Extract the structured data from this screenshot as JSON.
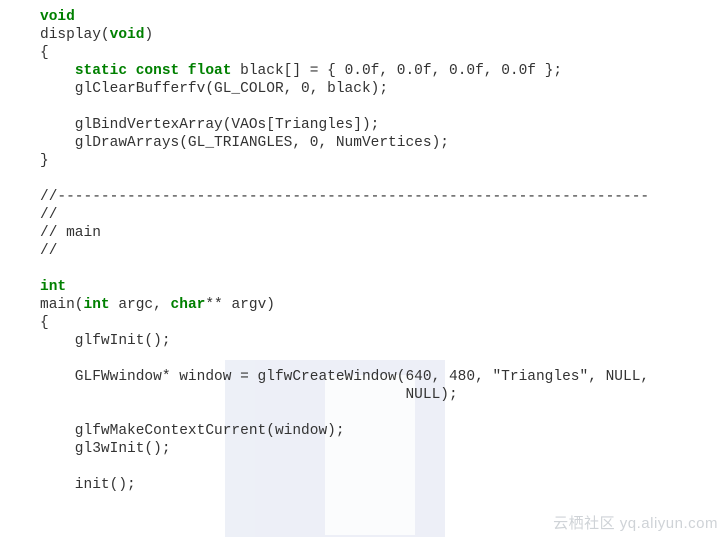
{
  "code": {
    "l01_kw": "void",
    "l02_a": "display(",
    "l02_kw": "void",
    "l02_b": ")",
    "l03": "{",
    "l04_a": "    ",
    "l04_kw": "static const float",
    "l04_b": " black[] = { 0.0f, 0.0f, 0.0f, 0.0f };",
    "l05": "    glClearBufferfv(GL_COLOR, 0, black);",
    "l06": "",
    "l07": "    glBindVertexArray(VAOs[Triangles]);",
    "l08": "    glDrawArrays(GL_TRIANGLES, 0, NumVertices);",
    "l09": "}",
    "l10": "",
    "l11": "//--------------------------------------------------------------------",
    "l12": "//",
    "l13": "// main",
    "l14": "//",
    "l15": "",
    "l16_kw": "int",
    "l17_a": "main(",
    "l17_kw1": "int",
    "l17_b": " argc, ",
    "l17_kw2": "char",
    "l17_c": "** argv)",
    "l18": "{",
    "l19": "    glfwInit();",
    "l20": "",
    "l21": "    GLFWwindow* window = glfwCreateWindow(640, 480, \"Triangles\", NULL,",
    "l22": "                                          NULL);",
    "l23": "",
    "l24": "    glfwMakeContextCurrent(window);",
    "l25": "    gl3wInit();",
    "l26": "",
    "l27": "    init();"
  },
  "watermark": "云栖社区 yq.aliyun.com"
}
